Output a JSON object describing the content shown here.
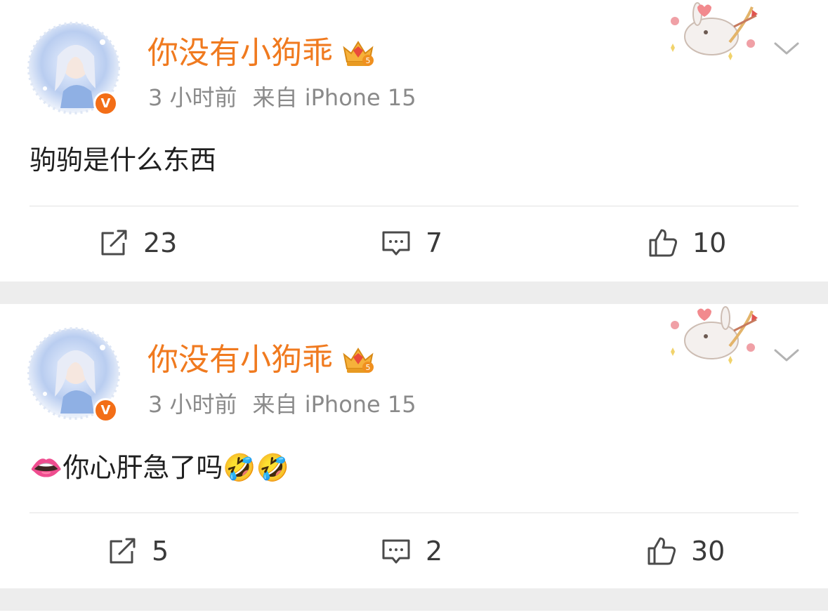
{
  "posts": [
    {
      "username": "你没有小狗乖",
      "vip_level": "5",
      "verified_mark": "V",
      "time": "3 小时前",
      "source": "来自 iPhone 15",
      "content": "驹驹是什么东西",
      "actions": {
        "repost": "23",
        "comment": "7",
        "like": "10"
      },
      "icons": [
        "avatar-image",
        "verified-badge-icon",
        "crown-vip-icon",
        "bunny-cupid-decoration",
        "chevron-down-icon",
        "repost-icon",
        "comment-icon",
        "like-icon"
      ]
    },
    {
      "username": "你没有小狗乖",
      "vip_level": "5",
      "verified_mark": "V",
      "time": "3 小时前",
      "source": "来自 iPhone 15",
      "content_emoji_lips": "👄",
      "content": "你心肝急了吗",
      "content_emoji_laugh": "🤣🤣",
      "actions": {
        "repost": "5",
        "comment": "2",
        "like": "30"
      },
      "icons": [
        "avatar-image",
        "verified-badge-icon",
        "crown-vip-icon",
        "bunny-cupid-decoration",
        "chevron-down-icon",
        "repost-icon",
        "comment-icon",
        "like-icon"
      ]
    }
  ],
  "colors": {
    "username": "#f07a1f",
    "meta": "#8a8a8a",
    "verified": "#f36e17",
    "separator": "#ededed"
  }
}
